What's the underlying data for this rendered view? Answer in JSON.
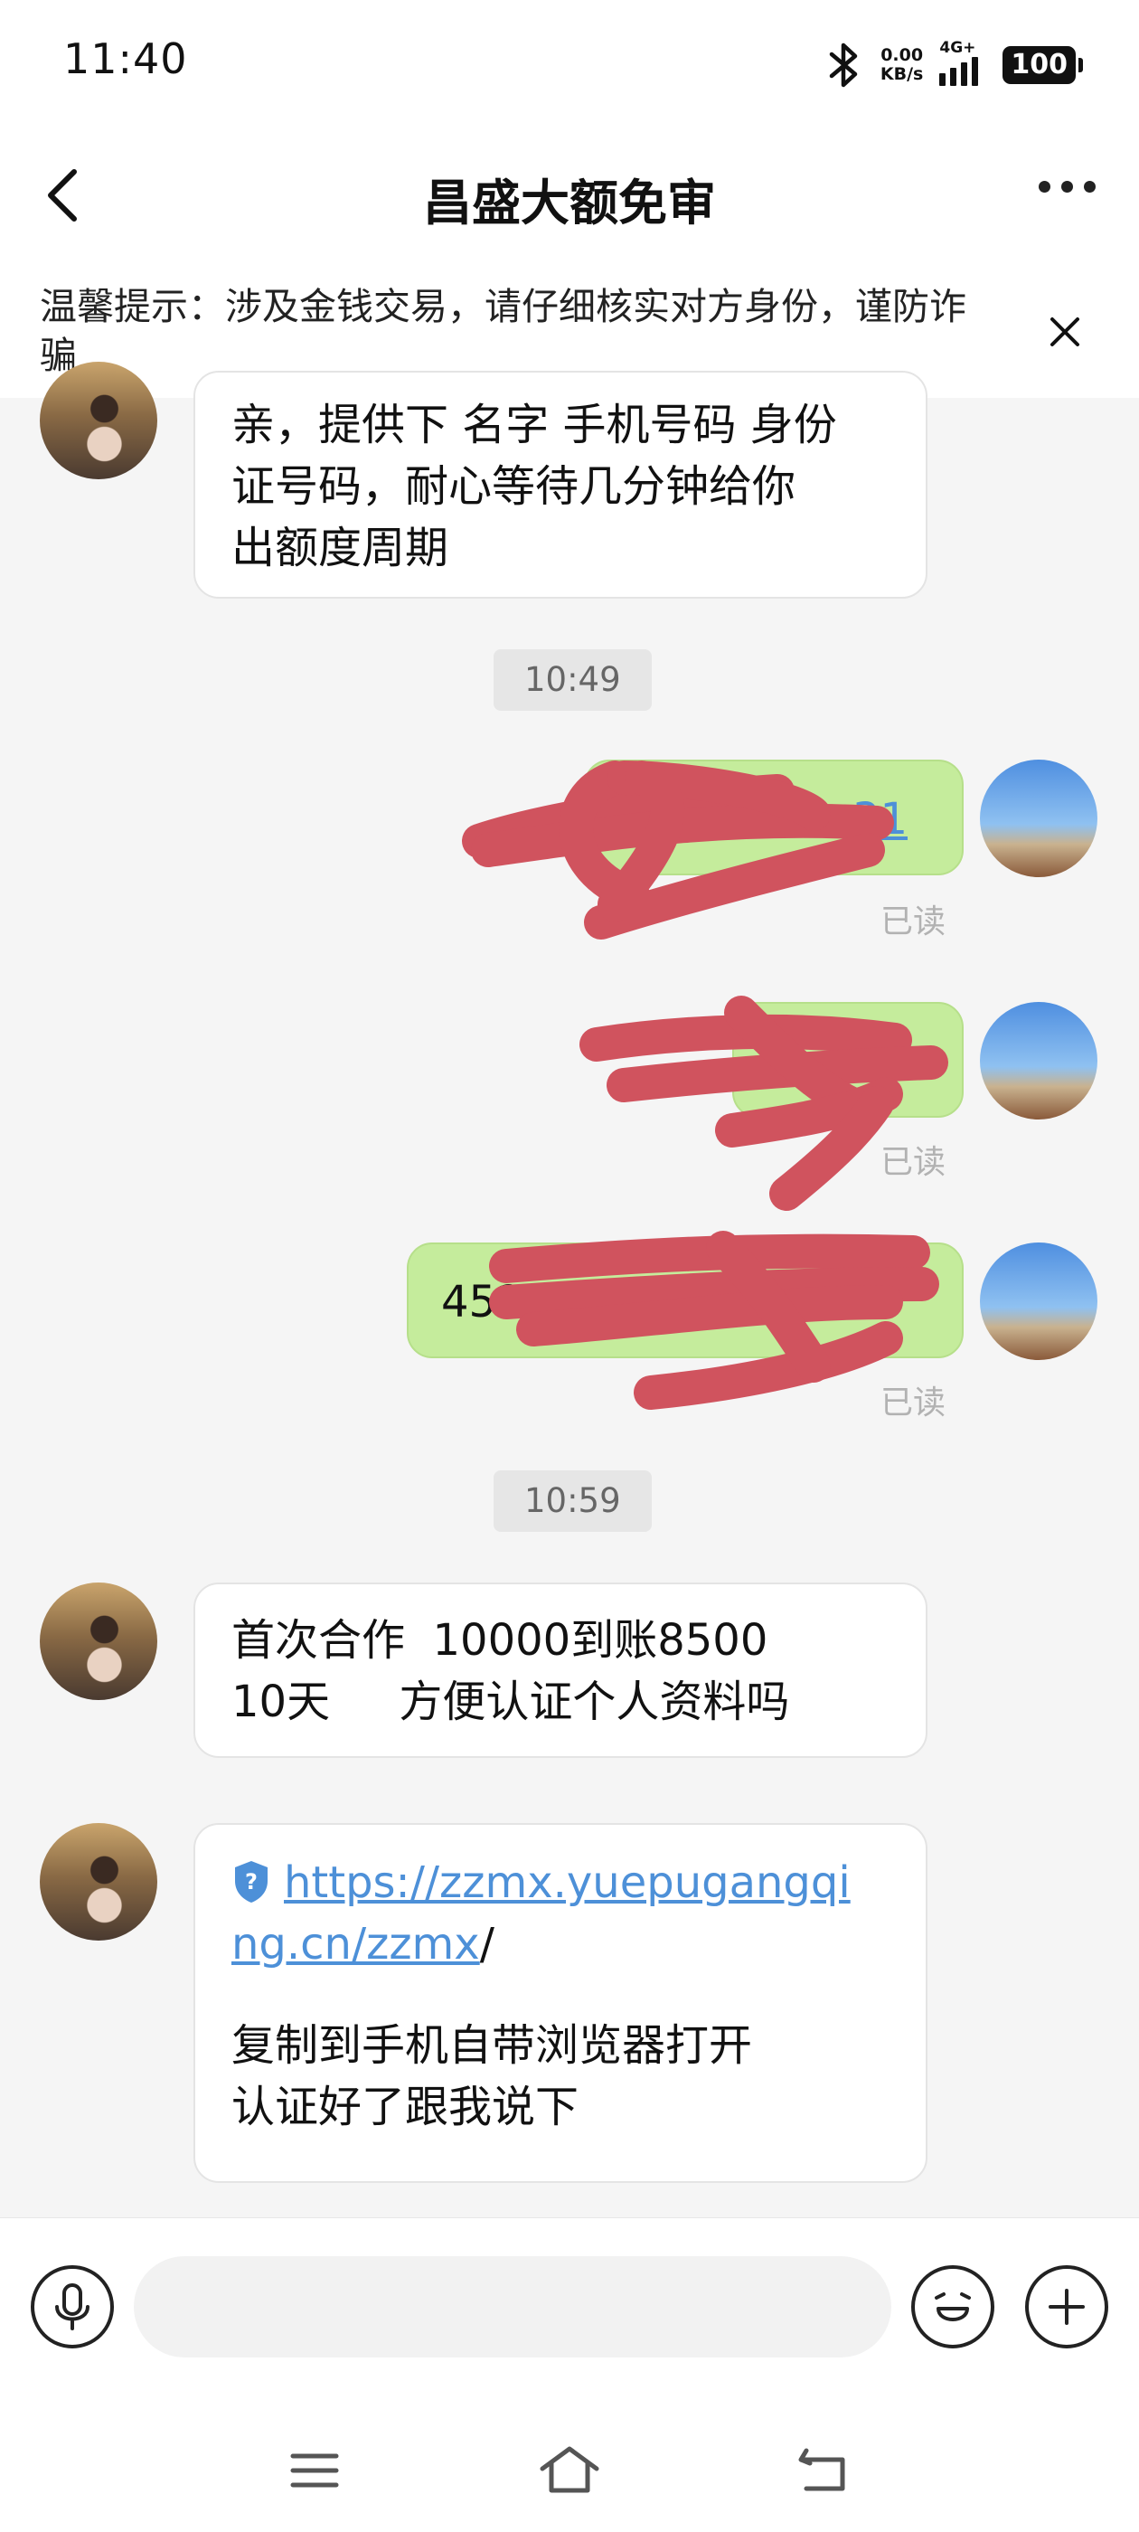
{
  "status_bar": {
    "time": "11:40",
    "speed_value": "0.00",
    "speed_unit": "KB/s",
    "network": "4G+",
    "battery": "100"
  },
  "header": {
    "title": "昌盛大额免审",
    "back_icon": "chevron-left-icon",
    "more_icon": "more-horizontal-icon"
  },
  "notice": {
    "text": "温馨提示：涉及金钱交易，请仔细核实对方身份，谨防诈骗",
    "close_icon": "close-icon"
  },
  "messages": {
    "m1": {
      "lines": [
        "亲，提供下 名字 手机号码 身份",
        "证号码，耐心等待几分钟给你",
        "出额度周期"
      ]
    },
    "time1": "10:49",
    "m2": {
      "visible_text": "31",
      "status": "已读"
    },
    "m3": {
      "status": "已读"
    },
    "m4": {
      "visible_text": "452",
      "status": "已读"
    },
    "time2": "10:59",
    "m5": {
      "line1": "首次合作  10000到账8500",
      "line2": "10天     方便认证个人资料吗"
    },
    "m6": {
      "link_line1": "https://zzmx.yuepugangqi",
      "link_line2": "ng.cn/zzmx",
      "link_suffix": "/",
      "line3": "复制到手机自带浏览器打开",
      "line4": "认证好了跟我说下"
    }
  },
  "input_bar": {
    "voice_icon": "microphone-icon",
    "emoji_icon": "emoji-icon",
    "plus_icon": "plus-icon",
    "placeholder": ""
  },
  "nav_bar": {
    "menu_icon": "menu-icon",
    "home_icon": "home-icon",
    "back_icon": "back-icon"
  },
  "colors": {
    "my_bubble": "#c5ec9c",
    "their_bubble": "#ffffff",
    "link": "#4d90d8",
    "redaction": "#d0535e",
    "background": "#f5f5f5"
  }
}
